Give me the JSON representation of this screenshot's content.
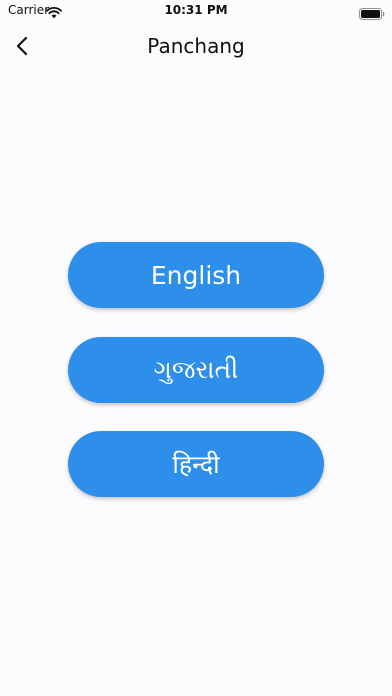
{
  "status_bar": {
    "carrier": "Carrier",
    "time": "10:31 PM"
  },
  "nav": {
    "title": "Panchang"
  },
  "languages": [
    {
      "label": "English"
    },
    {
      "label": "ગુજરાતી"
    },
    {
      "label": "हिन्दी"
    }
  ],
  "colors": {
    "button": "#2d8fe9",
    "button_text": "#ffffff",
    "background": "#fcfbfe"
  }
}
